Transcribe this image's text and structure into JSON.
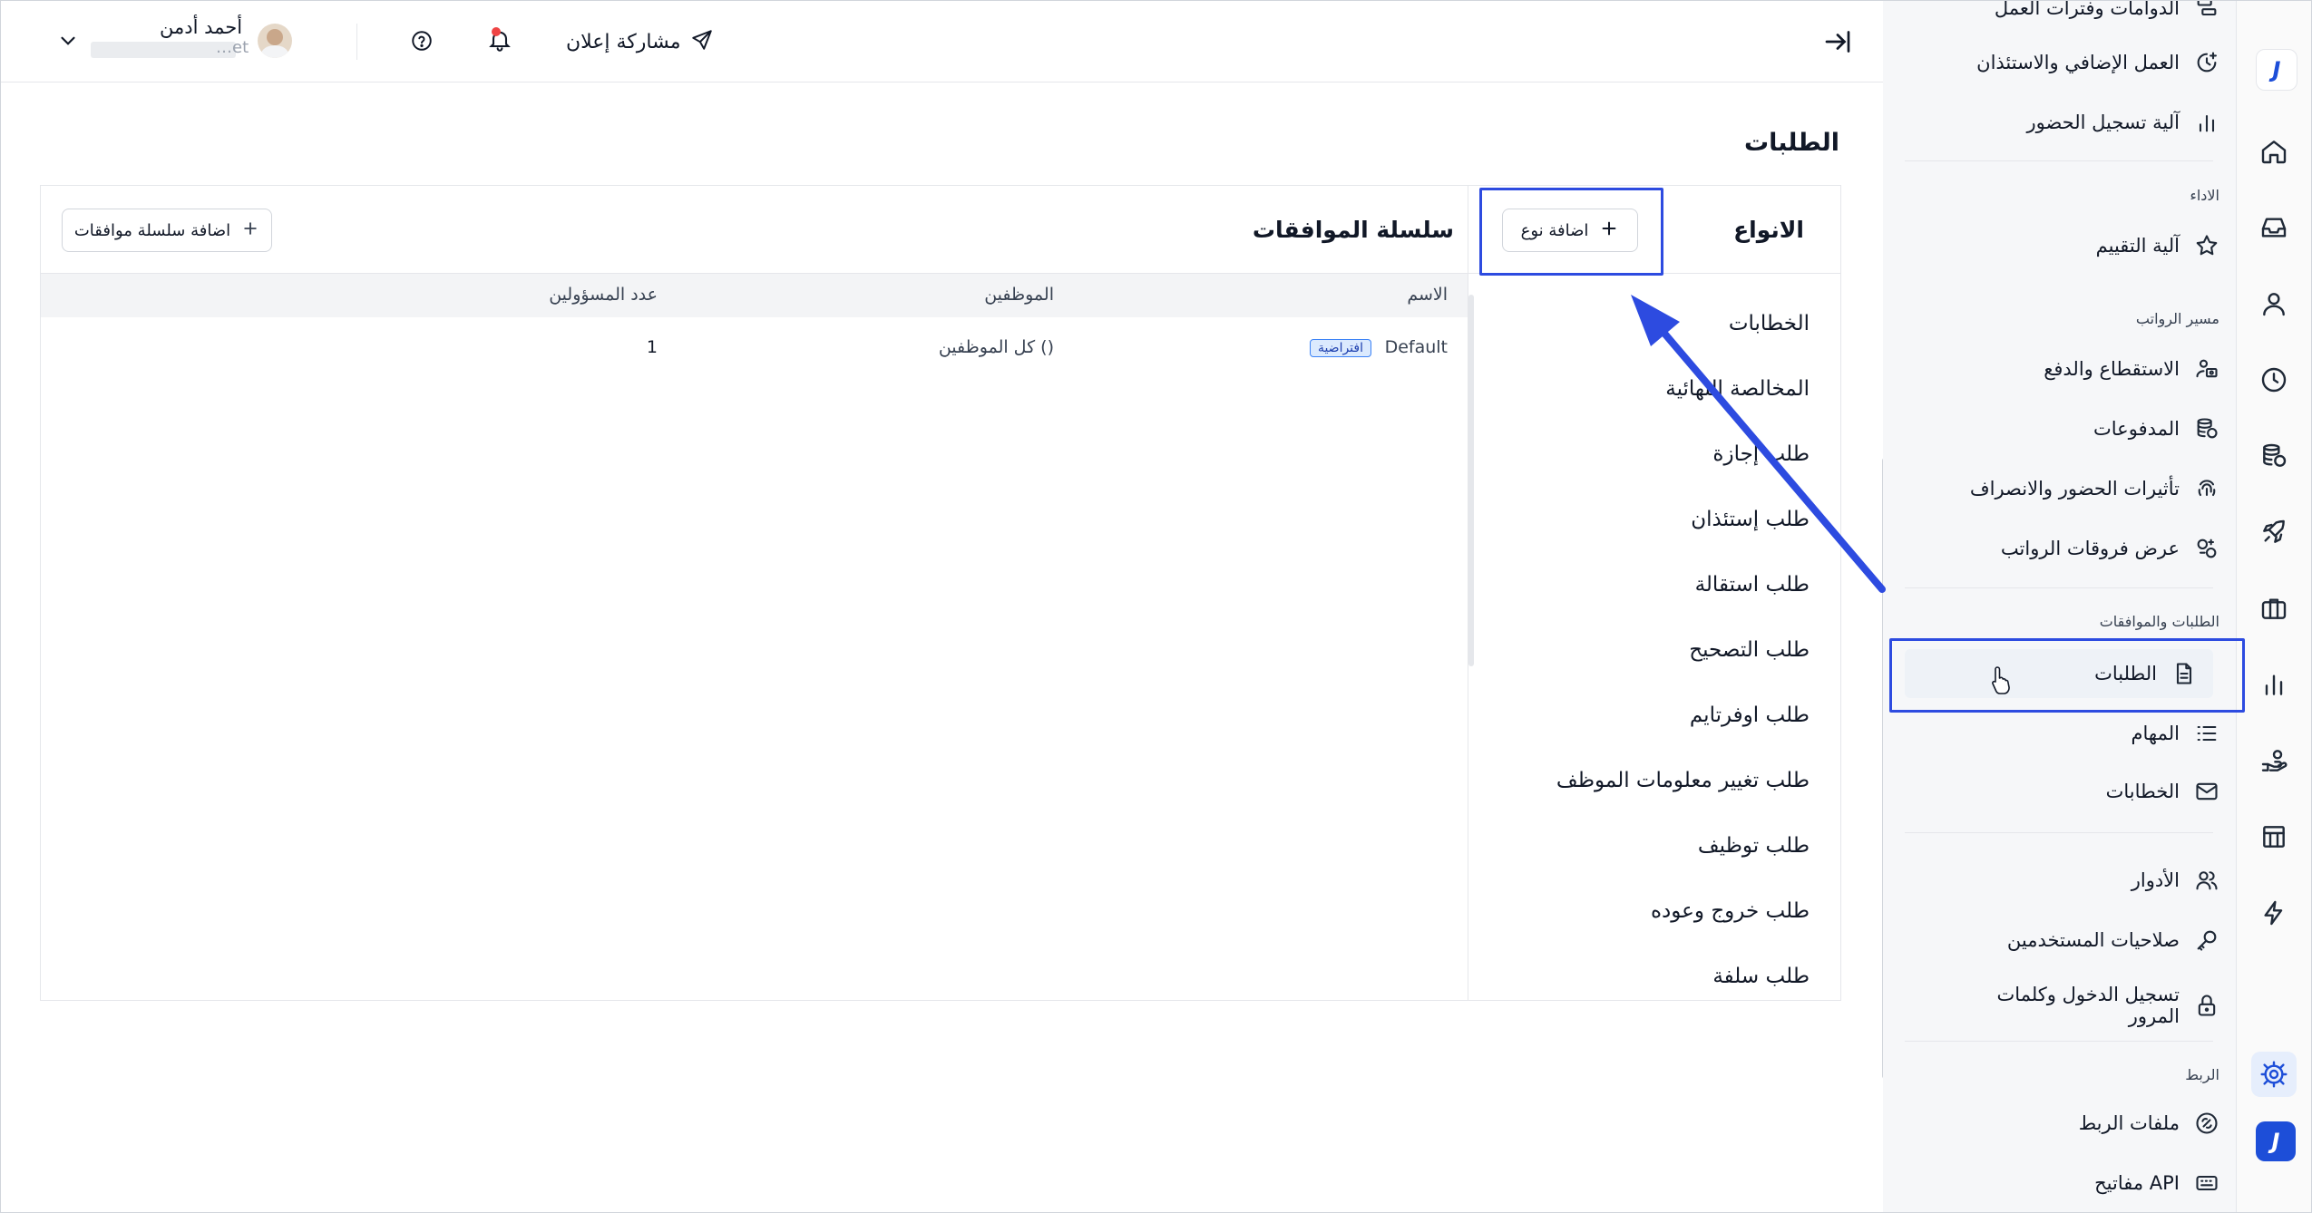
{
  "topbar": {
    "user_name": "أحمد أدمن",
    "user_sub": "…et",
    "share_label": "مشاركة إعلان"
  },
  "page": {
    "title": "الطلبات"
  },
  "types_panel": {
    "heading": "الانواع",
    "add_type_label": "اضافة نوع",
    "items": [
      "الخطابات",
      "المخالصة النهائية",
      "طلب إجازة",
      "طلب إستئذان",
      "طلب استقالة",
      "طلب التصحيح",
      "طلب اوفرتايم",
      "طلب تغيير معلومات الموظف",
      "طلب توظيف",
      "طلب خروج وعوده",
      "طلب سلفة"
    ]
  },
  "approvals_panel": {
    "heading": "سلسلة الموافقات",
    "add_chain_label": "اضافة سلسلة موافقات",
    "columns": [
      "الاسم",
      "الموظفين",
      "عدد المسؤولين"
    ],
    "rows": [
      {
        "name": "Default",
        "badge": "افتراضية",
        "employees": "كل الموظفين ()",
        "admins_count": "1"
      }
    ]
  },
  "settings_nav": {
    "items_top": [
      {
        "label": "الدوامات وفترات العمل",
        "icon": "shifts-icon"
      },
      {
        "label": "العمل الإضافي والاستئذان",
        "icon": "clock-plus-icon"
      },
      {
        "label": "آلية تسجيل الحضور",
        "icon": "bar-chart-icon"
      }
    ],
    "performance_section": "الاداء",
    "performance_items": [
      {
        "label": "آلية التقييم",
        "icon": "star-icon"
      }
    ],
    "payroll_section": "مسير الرواتب",
    "payroll_items": [
      {
        "label": "الاستقطاع والدفع",
        "icon": "people-money-icon"
      },
      {
        "label": "المدفوعات",
        "icon": "coins-icon"
      },
      {
        "label": "تأثيرات الحضور والانصراف",
        "icon": "fingerprint-icon"
      },
      {
        "label": "عرض فروقات الرواتب",
        "icon": "diff-icon"
      }
    ],
    "requests_section": "الطلبات والموافقات",
    "requests_items": [
      {
        "label": "الطلبات",
        "icon": "document-icon"
      },
      {
        "label": "المهام",
        "icon": "list-icon"
      },
      {
        "label": "الخطابات",
        "icon": "mail-icon"
      }
    ],
    "access_items": [
      {
        "label": "الأدوار",
        "icon": "users-icon"
      },
      {
        "label": "صلاحيات المستخدمين",
        "icon": "key-icon"
      },
      {
        "label_line1": "تسجيل الدخول وكلمات",
        "label_line2": "المرور",
        "icon": "lock-icon"
      }
    ],
    "integration_section": "الربط",
    "integration_items": [
      {
        "label": "ملفات الربط",
        "icon": "link-icon"
      },
      {
        "label": "مفاتيح API",
        "icon": "keyboard-icon"
      }
    ]
  },
  "rail": {
    "logo_letter": "J"
  },
  "colors": {
    "annotation": "#2d4be0",
    "brand": "#1d4ed8",
    "active_bg": "#eef2f7"
  }
}
